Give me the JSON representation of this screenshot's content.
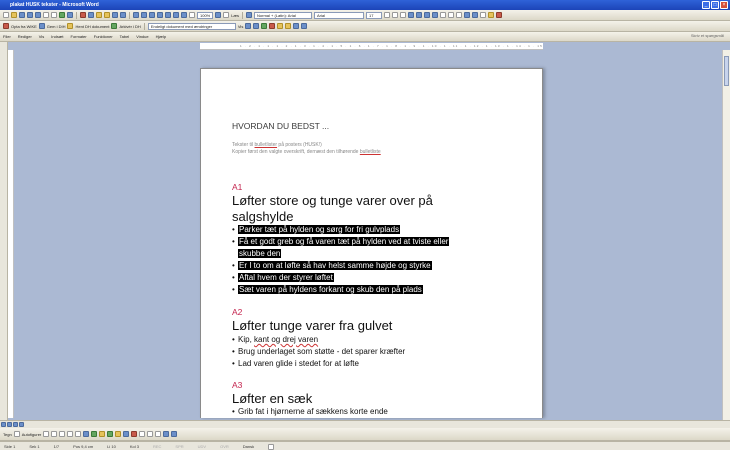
{
  "window": {
    "title": "plakat HUSK tekster - Microsoft Word"
  },
  "toolbar1": {
    "zoom": "100%",
    "read": "Læs",
    "style": "Normal + (Latin): Arial",
    "font": "Arial",
    "size": "17"
  },
  "toolbar2": {
    "pdf_label": "Opta fra WIKE",
    "save_label": "Gem i DIH",
    "save_as_label": "Hent DH dokument",
    "archive_label": "Arkivér i DH",
    "track_dropdown": "Endeligt dokument med ændringer",
    "show_label": "Vis"
  },
  "menu": {
    "items": [
      "Filer",
      "Rediger",
      "Vis",
      "Indsæt",
      "Formater",
      "Funktioner",
      "Tabel",
      "Vindue",
      "Hjælp"
    ],
    "help_box": "Skriv et spørgsmål"
  },
  "ruler": {
    "ticks": "1 · 2 · 1 · 1 · 1 · 2 · 1 · 3 · 1 · 4 · 1 · 5 · 1 · 6 · 1 · 7 · 1 · 8 · 1 · 9 · 1 · 10 · 1 · 11 · 1 · 12 · 1 · 13 · 1 · 14 · 1 · 15 · 1 · 16 ·"
  },
  "doc": {
    "title": "HVORDAN DU BEDST ...",
    "instr1_a": "Tekster til ",
    "instr1_link": "bulletlister",
    "instr1_b": " på posters (HUSK!)",
    "instr2_a": "Kopier først den valgte overskrift, dernæst den tilhørende ",
    "instr2_link": "bulletliste",
    "s1_tag": "A1",
    "s1_head1": "Løfter store og tunge varer over på",
    "s1_head2": "salgshylde",
    "s1_b1": "Parker tæt på hylden og sørg for fri gulvplads",
    "s1_b2a": "Få et godt greb og få varen tæt på hylden ved at tviste eller",
    "s1_b2b": "skubbe den",
    "s1_b3": "Er I to om at løfte så hav helst samme højde og styrke",
    "s1_b4": "Aftal hvem der styrer løftet",
    "s1_b5": "Sæt varen på hyldens forkant og skub den på plads",
    "s2_tag": "A2",
    "s2_head": "Løfter tunge varer fra gulvet",
    "s2_b1a": "Kip, ",
    "s2_b1b": "kant og drej varen",
    "s2_b2": "Brug underlaget som støtte - det sparer kræfter",
    "s2_b3": "Lad varen glide i stedet for at løfte",
    "s3_tag": "A3",
    "s3_head": "Løfter en sæk",
    "s3_b1": "Grib fat i hjørnerne af sækkens korte ende",
    "bullet": "•"
  },
  "drawbar": {
    "draw": "Tegn",
    "autoshapes": "Autofigurer"
  },
  "status": {
    "page": "Side 1",
    "section": "Sek 1",
    "pages": "1/7",
    "pos": "Pos 9,4 cm",
    "line": "Li 10",
    "col": "Kol 3",
    "rec": "REC",
    "trk": "SPR",
    "ext": "UDV",
    "ovr": "OVR",
    "lang": "Dansk"
  }
}
